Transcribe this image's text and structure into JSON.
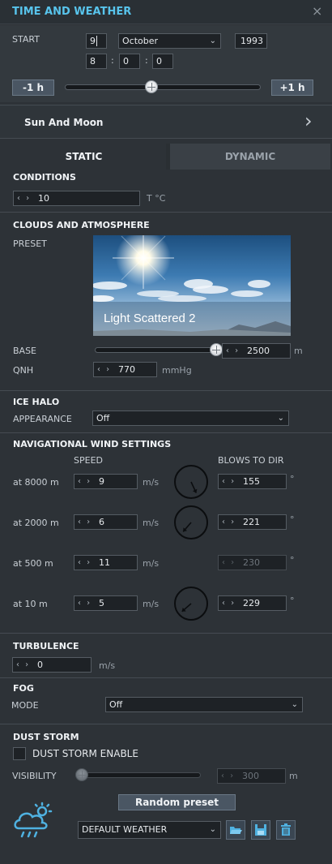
{
  "window": {
    "title": "TIME AND WEATHER",
    "close": "×"
  },
  "start": {
    "label": "START",
    "day": "9",
    "month": "October",
    "year": "1993",
    "hour": "8",
    "minute": "0",
    "second": "0",
    "sep1": ":",
    "sep2": ":",
    "minus_label": "-1 h",
    "plus_label": "+1 h",
    "time_slider_fraction": 0.44
  },
  "sun_moon": {
    "label": "Sun And Moon",
    "arrow": "›"
  },
  "tabs": [
    {
      "label": "STATIC"
    },
    {
      "label": "DYNAMIC"
    }
  ],
  "conditions": {
    "title": "CONDITIONS",
    "temperature": "10",
    "unit": "T °C"
  },
  "clouds": {
    "title": "CLOUDS AND ATMOSPHERE",
    "preset_label": "PRESET",
    "preset_name": "Light Scattered 2",
    "base_label": "BASE",
    "base_value": "2500",
    "base_unit": "m",
    "base_slider_fraction": 1.0,
    "qnh_label": "QNH",
    "qnh_value": "770",
    "qnh_unit": "mmHg"
  },
  "ice_halo": {
    "title": "ICE HALO",
    "appearance_label": "APPEARANCE",
    "appearance_value": "Off"
  },
  "wind": {
    "title": "NAVIGATIONAL WIND SETTINGS",
    "speed_header": "SPEED",
    "dir_header": "BLOWS TO DIR",
    "speed_unit": "m/s",
    "deg_unit": "°",
    "rows": [
      {
        "alt": "at 8000 m",
        "speed": "9",
        "dir": "155",
        "dir_deg": 155,
        "has_dial": true,
        "disabled": false
      },
      {
        "alt": "at 2000 m",
        "speed": "6",
        "dir": "221",
        "dir_deg": 221,
        "has_dial": true,
        "disabled": false
      },
      {
        "alt": "at 500 m",
        "speed": "11",
        "dir": "230",
        "dir_deg": 230,
        "has_dial": false,
        "disabled": true
      },
      {
        "alt": "at 10 m",
        "speed": "5",
        "dir": "229",
        "dir_deg": 229,
        "has_dial": true,
        "disabled": false
      }
    ]
  },
  "turbulence": {
    "title": "TURBULENCE",
    "value": "0",
    "unit": "m/s"
  },
  "fog": {
    "title": "FOG",
    "mode_label": "MODE",
    "mode_value": "Off"
  },
  "dust": {
    "title": "DUST STORM",
    "enable_label": "DUST STORM ENABLE",
    "enabled": false,
    "visibility_label": "VISIBILITY",
    "visibility_value": "300",
    "visibility_unit": "m",
    "visibility_slider_fraction": 0.0
  },
  "footer": {
    "random_label": "Random preset",
    "preset_select": "DEFAULT WEATHER",
    "icons": [
      "weather-cloud-icon",
      "folder-open-icon",
      "save-icon",
      "trash-icon"
    ]
  },
  "colors": {
    "title_blue": "#58c4ec",
    "icon_blue": "#4fb1e0",
    "panel": "#2d3237"
  }
}
